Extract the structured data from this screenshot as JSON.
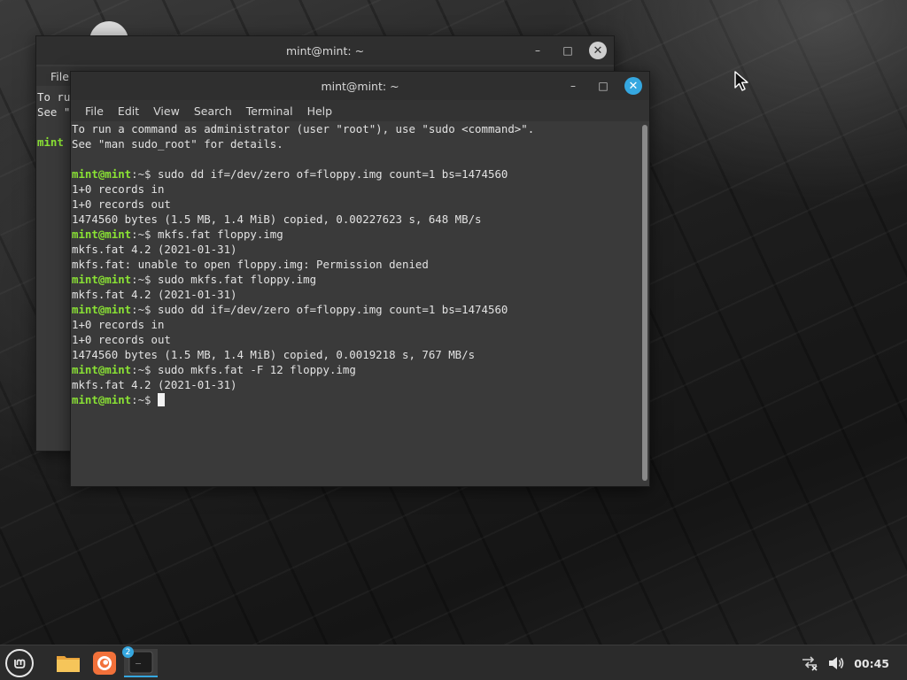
{
  "desktop": {},
  "back_window": {
    "title": "mint@mint: ~",
    "menu": [
      "File"
    ],
    "lines": [
      {
        "text": "To ru"
      },
      {
        "text": "See \""
      },
      {
        "text": ""
      },
      {
        "user": "mint",
        "path": ""
      }
    ]
  },
  "front_window": {
    "title": "mint@mint: ~",
    "menu": [
      "File",
      "Edit",
      "View",
      "Search",
      "Terminal",
      "Help"
    ],
    "lines": [
      {
        "type": "out",
        "text": "To run a command as administrator (user \"root\"), use \"sudo <command>\"."
      },
      {
        "type": "out",
        "text": "See \"man sudo_root\" for details."
      },
      {
        "type": "out",
        "text": ""
      },
      {
        "type": "cmd",
        "user": "mint@mint",
        "path": ":~$",
        "text": " sudo dd if=/dev/zero of=floppy.img count=1 bs=1474560"
      },
      {
        "type": "out",
        "text": "1+0 records in"
      },
      {
        "type": "out",
        "text": "1+0 records out"
      },
      {
        "type": "out",
        "text": "1474560 bytes (1.5 MB, 1.4 MiB) copied, 0.00227623 s, 648 MB/s"
      },
      {
        "type": "cmd",
        "user": "mint@mint",
        "path": ":~$",
        "text": " mkfs.fat floppy.img"
      },
      {
        "type": "out",
        "text": "mkfs.fat 4.2 (2021-01-31)"
      },
      {
        "type": "out",
        "text": "mkfs.fat: unable to open floppy.img: Permission denied"
      },
      {
        "type": "cmd",
        "user": "mint@mint",
        "path": ":~$",
        "text": " sudo mkfs.fat floppy.img"
      },
      {
        "type": "out",
        "text": "mkfs.fat 4.2 (2021-01-31)"
      },
      {
        "type": "cmd",
        "user": "mint@mint",
        "path": ":~$",
        "text": " sudo dd if=/dev/zero of=floppy.img count=1 bs=1474560"
      },
      {
        "type": "out",
        "text": "1+0 records in"
      },
      {
        "type": "out",
        "text": "1+0 records out"
      },
      {
        "type": "out",
        "text": "1474560 bytes (1.5 MB, 1.4 MiB) copied, 0.0019218 s, 767 MB/s"
      },
      {
        "type": "cmd",
        "user": "mint@mint",
        "path": ":~$",
        "text": " sudo mkfs.fat -F 12 floppy.img"
      },
      {
        "type": "out",
        "text": "mkfs.fat 4.2 (2021-01-31)"
      },
      {
        "type": "cmd",
        "user": "mint@mint",
        "path": ":~$",
        "text": " ",
        "cursor": true
      }
    ]
  },
  "taskbar": {
    "apps": [
      {
        "name": "files",
        "icon": "folder-icon"
      },
      {
        "name": "firefox",
        "icon": "firefox-icon"
      },
      {
        "name": "terminal",
        "icon": "terminal-icon",
        "badge": "2",
        "glyph": "_",
        "active": true
      }
    ],
    "clock": "00:45"
  },
  "colors": {
    "accent": "#35a7e0",
    "prompt": "#8ae234"
  }
}
